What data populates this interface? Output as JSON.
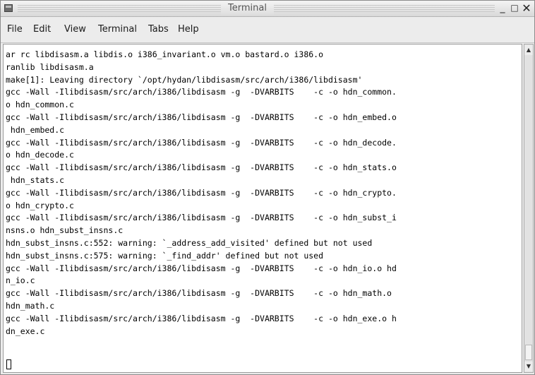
{
  "window": {
    "title": "Terminal",
    "buttons": {
      "minimize": "_",
      "maximize": "□",
      "close": "✕"
    }
  },
  "menu": {
    "items": [
      {
        "label": "File"
      },
      {
        "label": "Edit"
      },
      {
        "label": "View"
      },
      {
        "label": "Terminal"
      },
      {
        "label": "Tabs"
      },
      {
        "label": "Help"
      }
    ]
  },
  "terminal": {
    "lines": [
      "ar rc libdisasm.a libdis.o i386_invariant.o vm.o bastard.o i386.o",
      "ranlib libdisasm.a",
      "make[1]: Leaving directory `/opt/hydan/libdisasm/src/arch/i386/libdisasm'",
      "gcc -Wall -Ilibdisasm/src/arch/i386/libdisasm -g  -DVARBITS    -c -o hdn_common.",
      "o hdn_common.c",
      "gcc -Wall -Ilibdisasm/src/arch/i386/libdisasm -g  -DVARBITS    -c -o hdn_embed.o",
      " hdn_embed.c",
      "gcc -Wall -Ilibdisasm/src/arch/i386/libdisasm -g  -DVARBITS    -c -o hdn_decode.",
      "o hdn_decode.c",
      "gcc -Wall -Ilibdisasm/src/arch/i386/libdisasm -g  -DVARBITS    -c -o hdn_stats.o",
      " hdn_stats.c",
      "gcc -Wall -Ilibdisasm/src/arch/i386/libdisasm -g  -DVARBITS    -c -o hdn_crypto.",
      "o hdn_crypto.c",
      "gcc -Wall -Ilibdisasm/src/arch/i386/libdisasm -g  -DVARBITS    -c -o hdn_subst_i",
      "nsns.o hdn_subst_insns.c",
      "hdn_subst_insns.c:552: warning: `_address_add_visited' defined but not used",
      "hdn_subst_insns.c:575: warning: `_find_addr' defined but not used",
      "gcc -Wall -Ilibdisasm/src/arch/i386/libdisasm -g  -DVARBITS    -c -o hdn_io.o hd",
      "n_io.c",
      "gcc -Wall -Ilibdisasm/src/arch/i386/libdisasm -g  -DVARBITS    -c -o hdn_math.o",
      "hdn_math.c",
      "gcc -Wall -Ilibdisasm/src/arch/i386/libdisasm -g  -DVARBITS    -c -o hdn_exe.o h",
      "dn_exe.c"
    ]
  },
  "icons": {
    "window": "terminal-window-icon",
    "scroll_up": "scroll-up-arrow-icon",
    "scroll_down": "scroll-down-arrow-icon"
  }
}
